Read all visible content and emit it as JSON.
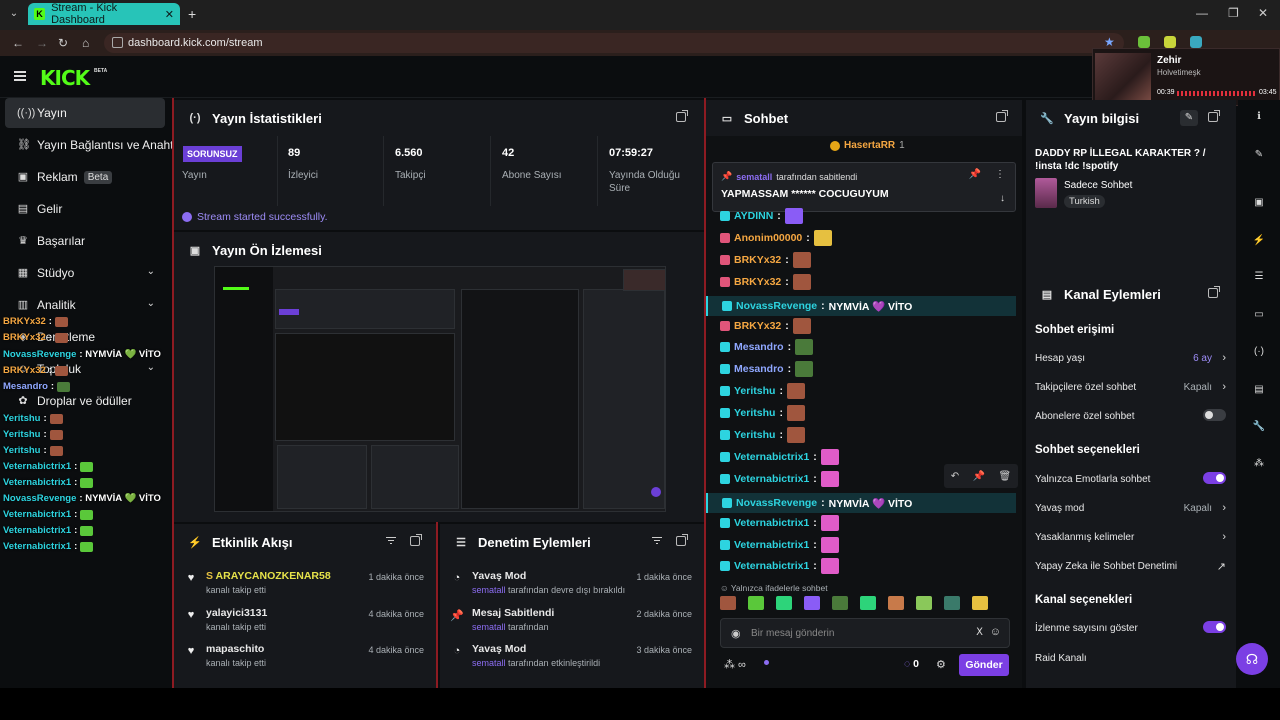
{
  "browser": {
    "tab_title": "Stream - Kick Dashboard",
    "url": "dashboard.kick.com/stream"
  },
  "media": {
    "title": "Zehir",
    "artist": "Holvetimeşk",
    "elapsed": "00:39",
    "total": "03:45"
  },
  "site": {
    "logo": "KICK",
    "logo_tag": "BETA"
  },
  "sidebar": {
    "items": [
      {
        "label": "Yayın",
        "icon": "broadcast-icon"
      },
      {
        "label": "Yayın Bağlantısı ve Anahtar",
        "icon": "link-icon"
      },
      {
        "label": "Reklam",
        "icon": "ad-icon",
        "badge": "Beta"
      },
      {
        "label": "Gelir",
        "icon": "chart-icon"
      },
      {
        "label": "Başarılar",
        "icon": "trophy-icon"
      },
      {
        "label": "Stüdyo",
        "icon": "studio-icon"
      },
      {
        "label": "Analitik",
        "icon": "analytics-icon"
      },
      {
        "label": "Denetleme",
        "icon": "shield-icon"
      },
      {
        "label": "Topluluk",
        "icon": "community-icon"
      },
      {
        "label": "Droplar ve ödüller",
        "icon": "gift-icon"
      }
    ]
  },
  "overlay_chat": [
    {
      "user": "BRKYx32",
      "sep": " :",
      "color": "#f5a742"
    },
    {
      "user": "BRKYx32",
      "sep": " :",
      "color": "#f5a742"
    },
    {
      "user": "NovassRevenge",
      "sep": " : NYMVİA 💚 VİTO",
      "color": "#2dd4e0"
    },
    {
      "user": "BRKYx32",
      "sep": " :",
      "color": "#f5a742"
    },
    {
      "user": "Mesandro",
      "sep": " :",
      "color": "#8fa7ff"
    },
    {
      "user": "Yeritshu",
      "sep": " :",
      "color": "#2dd4e0"
    },
    {
      "user": "Yeritshu",
      "sep": " :",
      "color": "#2dd4e0"
    },
    {
      "user": "Yeritshu",
      "sep": " :",
      "color": "#2dd4e0"
    },
    {
      "user": "Veternabictrix1",
      "sep": " :",
      "color": "#2dd4e0"
    },
    {
      "user": "Veternabictrix1",
      "sep": " :",
      "color": "#2dd4e0"
    },
    {
      "user": "NovassRevenge",
      "sep": " : NYMVİA 💚 VİTO",
      "color": "#2dd4e0"
    },
    {
      "user": "Veternabictrix1",
      "sep": " :",
      "color": "#2dd4e0"
    },
    {
      "user": "Veternabictrix1",
      "sep": " :",
      "color": "#2dd4e0"
    },
    {
      "user": "Veternabictrix1",
      "sep": " :",
      "color": "#2dd4e0"
    }
  ],
  "stats": {
    "title": "Yayın İstatistikleri",
    "status_badge": "SORUNSUZ",
    "status_label": "Yayın",
    "items": [
      {
        "value": "89",
        "label": "İzleyici"
      },
      {
        "value": "6.560",
        "label": "Takipçi"
      },
      {
        "value": "42",
        "label": "Abone Sayısı"
      },
      {
        "value": "07:59:27",
        "label": "Yayında Olduğu Süre"
      }
    ],
    "success": "Stream started successfully."
  },
  "preview": {
    "title": "Yayın Ön İzlemesi"
  },
  "activity": {
    "title": "Etkinlik Akışı",
    "items": [
      {
        "name": "ARAYCANOZKENAR58",
        "sub": "kanalı takip etti",
        "time": "1 dakika önce"
      },
      {
        "name": "yalayici3131",
        "sub": "kanalı takip etti",
        "time": "4 dakika önce"
      },
      {
        "name": "mapaschito",
        "sub": "kanalı takip etti",
        "time": "4 dakika önce"
      }
    ]
  },
  "moderation": {
    "title": "Denetim Eylemleri",
    "items": [
      {
        "name": "Yavaş Mod",
        "actor": "sematall",
        "sub": "tarafından devre dışı bırakıldı",
        "time": "1 dakika önce"
      },
      {
        "name": "Mesaj Sabitlendi",
        "actor": "sematall",
        "sub": "tarafından",
        "time": "2 dakika önce"
      },
      {
        "name": "Yavaş Mod",
        "actor": "sematall",
        "sub": "tarafından etkinleştirildi",
        "time": "3 dakika önce"
      }
    ]
  },
  "chat": {
    "title": "Sohbet",
    "top_user": "HasertaRR",
    "top_count": "1",
    "pinned_by_user": "sematall",
    "pinned_by_text": "tarafından sabitlendi",
    "pinned_message": "YAPMASSAM ****** COCUGUYUM",
    "messages": [
      {
        "user": "AYDINN",
        "text": "",
        "color": "#2dd4e0",
        "emote": "#8a5cf6"
      },
      {
        "user": "Anonim00000",
        "text": "",
        "color": "#f5a742",
        "emote": "#e6c040"
      },
      {
        "user": "BRKYx32",
        "text": "",
        "color": "#f5a742",
        "emote": "#a0563e"
      },
      {
        "user": "BRKYx32",
        "text": "",
        "color": "#f5a742",
        "emote": "#a0563e"
      },
      {
        "user": "NovassRevenge",
        "text": "NYMVİA 💜 VİTO",
        "color": "#2dd4e0",
        "emote": ""
      },
      {
        "user": "BRKYx32",
        "text": "",
        "color": "#f5a742",
        "emote": "#a0563e"
      },
      {
        "user": "Mesandro",
        "text": "",
        "color": "#8fa7ff",
        "emote": "#4a7a3a"
      },
      {
        "user": "Mesandro",
        "text": "",
        "color": "#8fa7ff",
        "emote": "#4a7a3a"
      },
      {
        "user": "Yeritshu",
        "text": "",
        "color": "#2dd4e0",
        "emote": "#a0563e"
      },
      {
        "user": "Yeritshu",
        "text": "",
        "color": "#2dd4e0",
        "emote": "#a0563e"
      },
      {
        "user": "Yeritshu",
        "text": "",
        "color": "#2dd4e0",
        "emote": "#a0563e"
      },
      {
        "user": "Veternabictrix1",
        "text": "",
        "color": "#2dd4e0",
        "emote": "#e05cc8"
      },
      {
        "user": "Veternabictrix1",
        "text": "",
        "color": "#2dd4e0",
        "emote": "#e05cc8"
      },
      {
        "user": "NovassRevenge",
        "text": "NYMVİA 💜 VİTO",
        "color": "#2dd4e0",
        "emote": ""
      },
      {
        "user": "Veternabictrix1",
        "text": "",
        "color": "#2dd4e0",
        "emote": "#e05cc8"
      },
      {
        "user": "Veternabictrix1",
        "text": "",
        "color": "#2dd4e0",
        "emote": "#e05cc8"
      },
      {
        "user": "Veternabictrix1",
        "text": "",
        "color": "#2dd4e0",
        "emote": "#e05cc8"
      }
    ],
    "emote_only_notice": "Yalnızca ifadelerle sohbet",
    "input_placeholder": "Bir mesaj gönderin",
    "points": "0",
    "send_label": "Gönder"
  },
  "stream_info": {
    "title": "Yayın bilgisi",
    "stream_title": "DADDY RP İLLEGAL KARAKTER ? / !insta !dc !spotify",
    "category": "Sadece Sohbet",
    "language": "Turkish"
  },
  "channel_actions": {
    "title": "Kanal Eylemleri",
    "chat_access_title": "Sohbet erişimi",
    "account_age_label": "Hesap yaşı",
    "account_age_value": "6 ay",
    "followers_only_label": "Takipçilere özel sohbet",
    "followers_only_value": "Kapalı",
    "subs_only_label": "Abonelere özel sohbet",
    "chat_options_title": "Sohbet seçenekleri",
    "emote_only_label": "Yalnızca Emotlarla sohbet",
    "slow_mode_label": "Yavaş mod",
    "slow_mode_value": "Kapalı",
    "banned_words_label": "Yasaklanmış kelimeler",
    "ai_moderation_label": "Yapay Zeka ile Sohbet Denetimi",
    "channel_options_title": "Kanal seçenekleri",
    "show_viewers_label": "İzlenme sayısını göster",
    "raid_label": "Raid Kanalı"
  },
  "colors": {
    "accent": "#7b3fe4",
    "brand": "#53fc18"
  }
}
